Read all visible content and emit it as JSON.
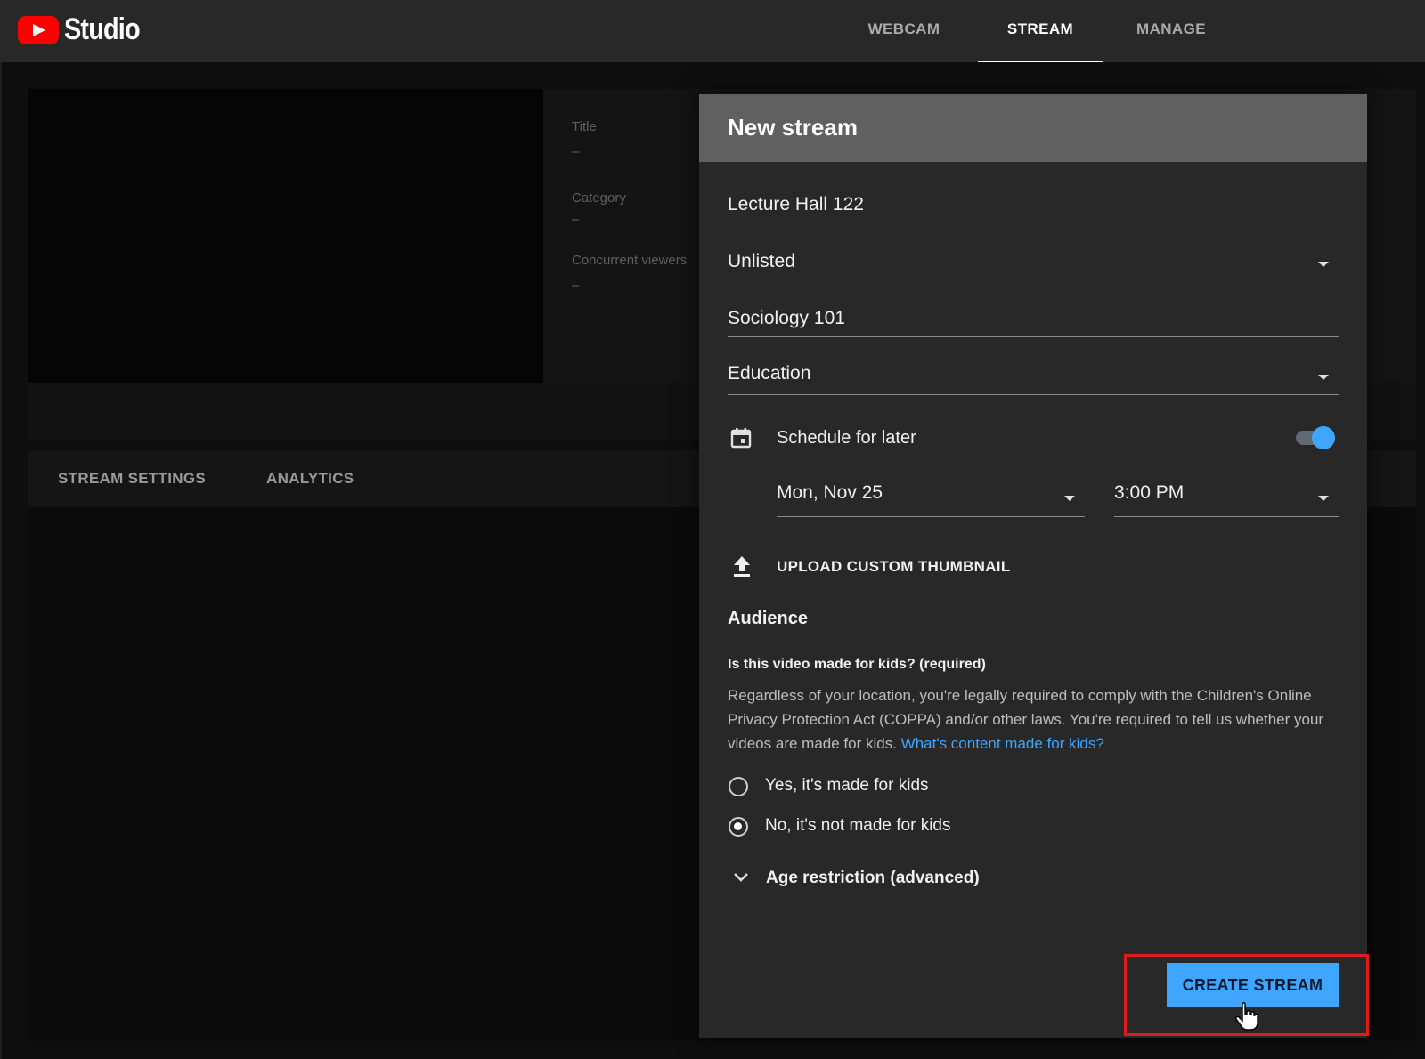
{
  "app": {
    "name": "Studio"
  },
  "nav": {
    "tabs": [
      "WEBCAM",
      "STREAM",
      "MANAGE"
    ],
    "active": "STREAM"
  },
  "background": {
    "info": [
      {
        "label": "Title",
        "value": "–"
      },
      {
        "label": "Category",
        "value": "–"
      },
      {
        "label": "Concurrent viewers",
        "value": "–"
      }
    ],
    "tabs": [
      "STREAM SETTINGS",
      "ANALYTICS"
    ]
  },
  "dialog": {
    "title": "New stream",
    "stream_name": "Lecture Hall 122",
    "visibility": "Unlisted",
    "description": "Sociology 101",
    "category": "Education",
    "schedule_label": "Schedule for later",
    "schedule_enabled": true,
    "date": "Mon, Nov 25",
    "time": "3:00 PM",
    "upload_thumbnail": "UPLOAD CUSTOM THUMBNAIL",
    "audience_heading": "Audience",
    "kids_question": "Is this video made for kids? (required)",
    "kids_description": "Regardless of your location, you're legally required to comply with the Children's Online Privacy Protection Act (COPPA) and/or other laws. You're required to tell us whether your videos are made for kids.",
    "kids_link": "What's content made for kids?",
    "option_yes": "Yes, it's made for kids",
    "option_no": "No, it's not made for kids",
    "selected_option": "no",
    "age_restriction": "Age restriction (advanced)",
    "create_button": "CREATE STREAM"
  },
  "colors": {
    "accent": "#3ea6ff",
    "highlight": "#e11b1b",
    "brand": "#ff0000"
  }
}
